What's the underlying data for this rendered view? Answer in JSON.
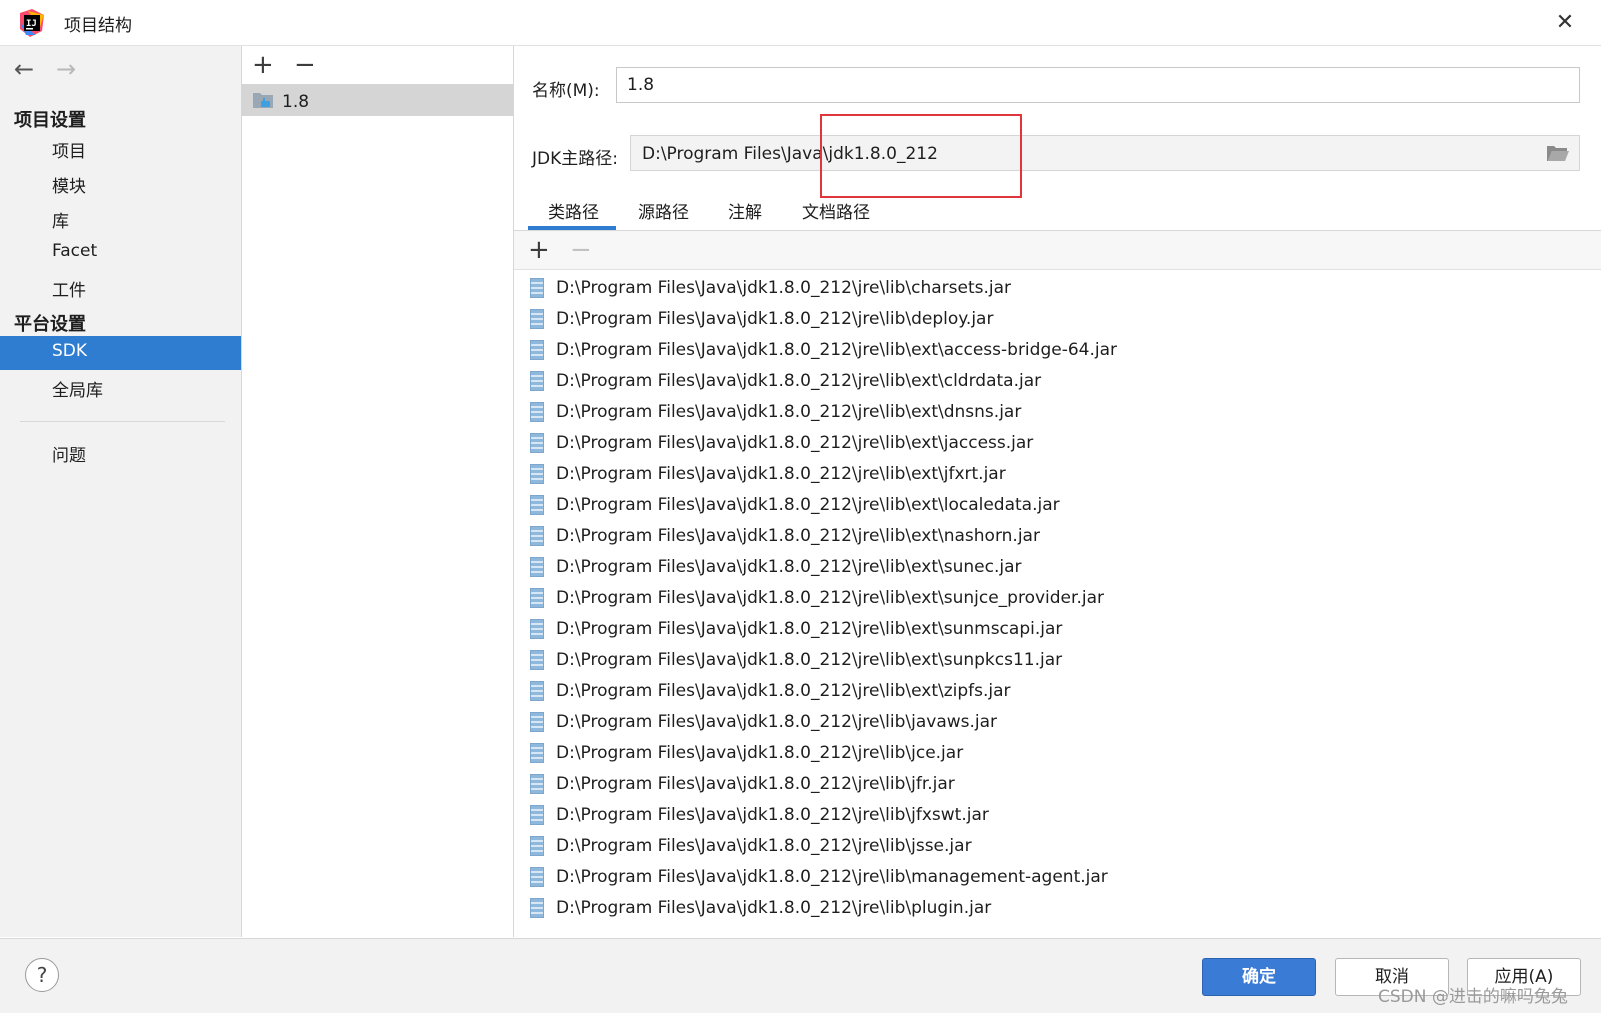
{
  "window": {
    "title": "项目结构",
    "close": "✕"
  },
  "nav": {
    "back": "←",
    "forward": "→",
    "project_settings": "项目设置",
    "items1": [
      "项目",
      "模块",
      "库",
      "Facet",
      "工件"
    ],
    "platform_settings": "平台设置",
    "sdk": "SDK",
    "global_libs": "全局库",
    "problems": "问题"
  },
  "sdk_list": {
    "add": "+",
    "remove": "−",
    "items": [
      "1.8"
    ]
  },
  "form": {
    "name_label": "名称(M):",
    "name_value": "1.8",
    "jdk_label": "JDK主路径:",
    "jdk_value": "D:\\Program Files\\Java\\jdk1.8.0_212"
  },
  "tabs": [
    "类路径",
    "源路径",
    "注解",
    "文档路径"
  ],
  "list_toolbar": {
    "add": "+",
    "remove": "−"
  },
  "classpath": [
    "D:\\Program Files\\Java\\jdk1.8.0_212\\jre\\lib\\charsets.jar",
    "D:\\Program Files\\Java\\jdk1.8.0_212\\jre\\lib\\deploy.jar",
    "D:\\Program Files\\Java\\jdk1.8.0_212\\jre\\lib\\ext\\access-bridge-64.jar",
    "D:\\Program Files\\Java\\jdk1.8.0_212\\jre\\lib\\ext\\cldrdata.jar",
    "D:\\Program Files\\Java\\jdk1.8.0_212\\jre\\lib\\ext\\dnsns.jar",
    "D:\\Program Files\\Java\\jdk1.8.0_212\\jre\\lib\\ext\\jaccess.jar",
    "D:\\Program Files\\Java\\jdk1.8.0_212\\jre\\lib\\ext\\jfxrt.jar",
    "D:\\Program Files\\Java\\jdk1.8.0_212\\jre\\lib\\ext\\localedata.jar",
    "D:\\Program Files\\Java\\jdk1.8.0_212\\jre\\lib\\ext\\nashorn.jar",
    "D:\\Program Files\\Java\\jdk1.8.0_212\\jre\\lib\\ext\\sunec.jar",
    "D:\\Program Files\\Java\\jdk1.8.0_212\\jre\\lib\\ext\\sunjce_provider.jar",
    "D:\\Program Files\\Java\\jdk1.8.0_212\\jre\\lib\\ext\\sunmscapi.jar",
    "D:\\Program Files\\Java\\jdk1.8.0_212\\jre\\lib\\ext\\sunpkcs11.jar",
    "D:\\Program Files\\Java\\jdk1.8.0_212\\jre\\lib\\ext\\zipfs.jar",
    "D:\\Program Files\\Java\\jdk1.8.0_212\\jre\\lib\\javaws.jar",
    "D:\\Program Files\\Java\\jdk1.8.0_212\\jre\\lib\\jce.jar",
    "D:\\Program Files\\Java\\jdk1.8.0_212\\jre\\lib\\jfr.jar",
    "D:\\Program Files\\Java\\jdk1.8.0_212\\jre\\lib\\jfxswt.jar",
    "D:\\Program Files\\Java\\jdk1.8.0_212\\jre\\lib\\jsse.jar",
    "D:\\Program Files\\Java\\jdk1.8.0_212\\jre\\lib\\management-agent.jar",
    "D:\\Program Files\\Java\\jdk1.8.0_212\\jre\\lib\\plugin.jar"
  ],
  "footer": {
    "help": "?",
    "ok": "确定",
    "cancel": "取消",
    "apply": "应用(A)",
    "watermark": "CSDN @进击的嘛吗兔兔"
  },
  "colors": {
    "accent": "#2f7dd1",
    "highlight_box": "#e0353a"
  }
}
